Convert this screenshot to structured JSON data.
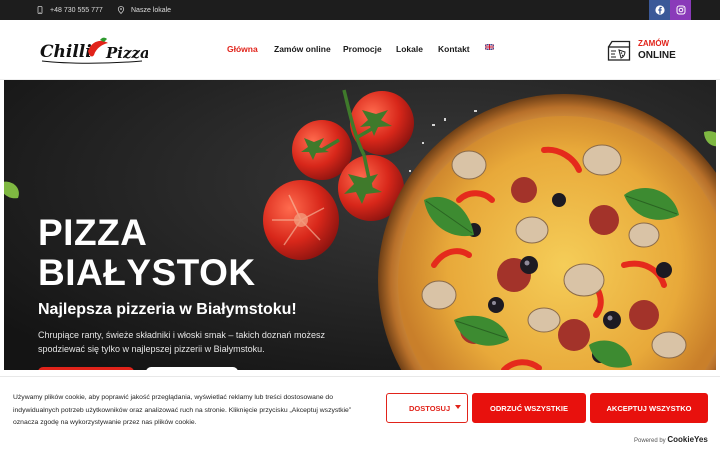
{
  "topbar": {
    "phone": "+48 730 555 777",
    "locations": "Nasze lokale",
    "social": [
      {
        "name": "facebook",
        "color": "#3b5998"
      },
      {
        "name": "instagram",
        "color": "#8a3ab9"
      }
    ]
  },
  "header": {
    "logo_text": "Chilli Pizza",
    "nav": [
      "Główna",
      "Zamów online",
      "Promocje",
      "Lokale",
      "Kontakt"
    ],
    "active_nav": "Główna",
    "language_icon": "uk-flag",
    "order_line1": "ZAMÓW",
    "order_line2": "ONLINE"
  },
  "hero": {
    "title_line1": "PIZZA",
    "title_line2": "BIAŁYSTOK",
    "subtitle": "Najlepsza pizzeria w Białymstoku!",
    "text": "Chrupiące ranty, świeże składniki i włoski smak – takich doznań możesz spodziewać się tylko w najlepszej pizzerii w Białymstoku."
  },
  "cookie": {
    "message": "Używamy plików cookie, aby poprawić jakość przeglądania, wyświetlać reklamy lub treści dostosowane do indywidualnych potrzeb użytkowników oraz analizować ruch na stronie. Kliknięcie przycisku „Akceptuj wszystkie” oznacza zgodę na wykorzystywanie przez nas plików cookie.",
    "customize": "DOSTOSUJ",
    "reject": "ODRZUĆ WSZYSTKIE",
    "accept": "AKCEPTUJ WSZYSTKO",
    "powered_by": "Powered by",
    "brand": "CookieYes"
  },
  "colors": {
    "accent": "#e1231a",
    "dark": "#1d1d1d"
  }
}
